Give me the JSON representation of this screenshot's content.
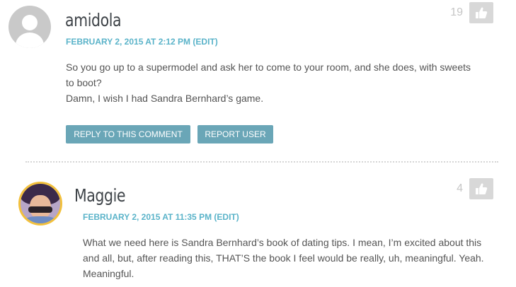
{
  "comments": [
    {
      "author": "amidola",
      "date": "FEBRUARY 2, 2015 AT 2:12 PM",
      "edit": "(EDIT)",
      "avatar_icon": "default-user-avatar",
      "body_lines": [
        "So you go up to a supermodel and ask her to come to your room, and she does, with sweets to boot?",
        "Damn, I wish I had Sandra Bernhard’s game."
      ],
      "votes": "19",
      "reply_label": "REPLY TO THIS COMMENT",
      "report_label": "REPORT USER"
    },
    {
      "author": "Maggie",
      "date": "FEBRUARY 2, 2015 AT 11:35 PM",
      "edit": "(EDIT)",
      "avatar_icon": "user-photo-avatar",
      "body_lines": [
        "What we need here is Sandra Bernhard’s book of dating tips. I mean, I’m excited about this and all, but, after reading this, THAT’S the book I feel would be really, uh, meaningful. Yeah. Meaningful."
      ],
      "votes": "4"
    }
  ],
  "colors": {
    "accent": "#5ab3c9",
    "button": "#6aa6b7",
    "avatar_border": "#f2c03c",
    "like_bg": "#d8d8d8"
  },
  "icons": {
    "like": "thumbs-up-icon"
  }
}
